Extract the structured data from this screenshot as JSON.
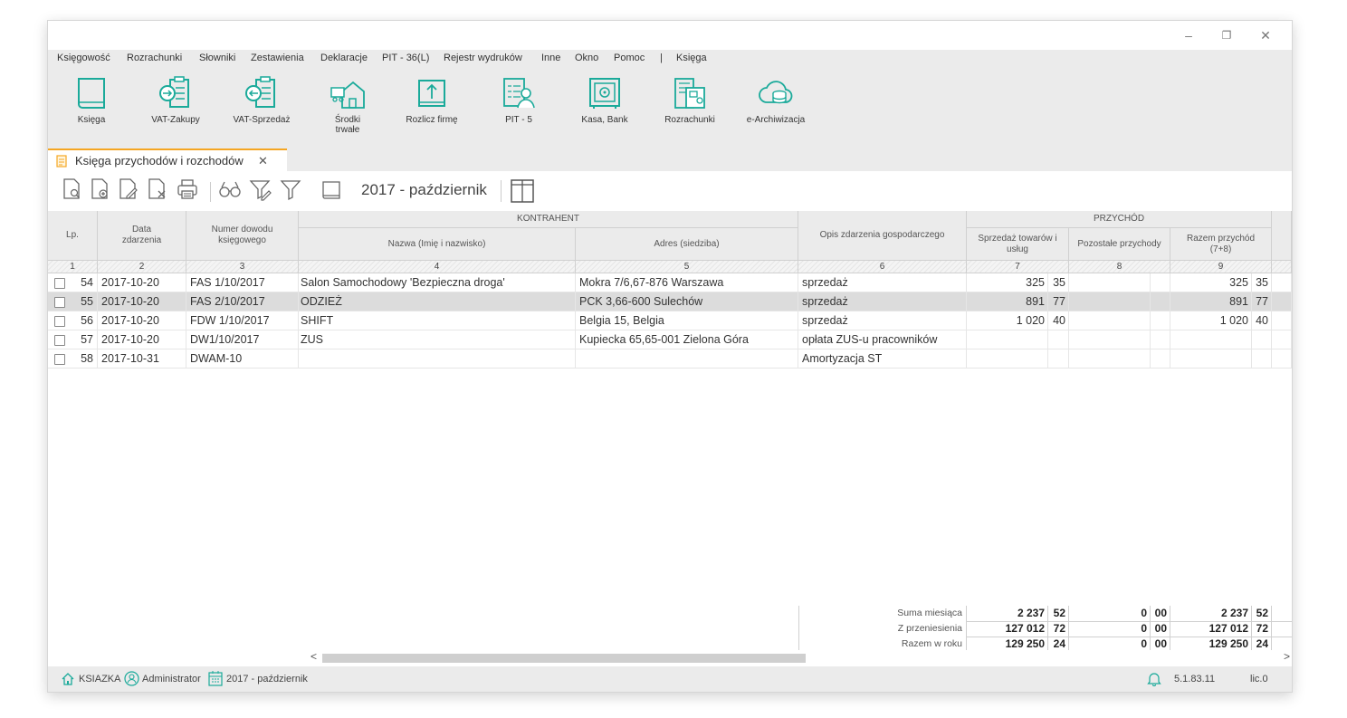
{
  "window": {
    "controls": {
      "minimize": "–",
      "restore": "❐",
      "close": "✕"
    }
  },
  "menu": [
    "Księgowość",
    "Rozrachunki",
    "Słowniki",
    "Zestawienia",
    "Deklaracje",
    "PIT - 36(L)",
    "Rejestr wydruków",
    "Inne",
    "Okno",
    "Pomoc",
    "|",
    "Księga"
  ],
  "ribbon": [
    {
      "label": "Księga",
      "icon": "book-icon"
    },
    {
      "label": "VAT-Zakupy",
      "icon": "document-in-icon"
    },
    {
      "label": "VAT-Sprzedaż",
      "icon": "document-out-icon"
    },
    {
      "label": "Środki trwałe",
      "icon": "fixed-assets-icon"
    },
    {
      "label": "Rozlicz firmę",
      "icon": "settle-icon"
    },
    {
      "label": "PIT - 5",
      "icon": "pit-icon"
    },
    {
      "label": "Kasa, Bank",
      "icon": "safe-icon"
    },
    {
      "label": "Rozrachunki",
      "icon": "settlements-icon"
    },
    {
      "label": "e-Archiwizacja",
      "icon": "cloud-archive-icon"
    }
  ],
  "tab": {
    "label": "Księga przychodów i rozchodów",
    "close": "✕"
  },
  "toolbar": {
    "period": "2017 - październik"
  },
  "accent": "#1aaa9a",
  "tab_accent": "#f5a623",
  "table": {
    "headers": {
      "lp": "Lp.",
      "data": "Data zdarzenia",
      "numer": "Numer dowodu księgowego",
      "kontrahent": "KONTRAHENT",
      "nazwa": "Nazwa (Imię i nazwisko)",
      "adres": "Adres (siedziba)",
      "opis": "Opis zdarzenia gospodarczego",
      "przychod": "PRZYCHÓD",
      "sprzedaz": "Sprzedaż towarów i usług",
      "pozostale": "Pozostałe przychody",
      "razem": "Razem przychód (7+8)"
    },
    "col_numbers": [
      "1",
      "2",
      "3",
      "4",
      "5",
      "6",
      "7",
      "8",
      "9"
    ],
    "rows": [
      {
        "lp": "54",
        "data": "2017-10-20",
        "numer": "FAS 1/10/2017",
        "nazwa": "Salon Samochodowy 'Bezpieczna droga'",
        "adres": "Mokra 7/6,67-876 Warszawa",
        "opis": "sprzedaż",
        "s_int": "325",
        "s_dec": "35",
        "p_int": "",
        "p_dec": "",
        "r_int": "325",
        "r_dec": "35"
      },
      {
        "lp": "55",
        "data": "2017-10-20",
        "numer": "FAS 2/10/2017",
        "nazwa": "ODZIEŻ",
        "adres": "PCK 3,66-600 Sulechów",
        "opis": "sprzedaż",
        "s_int": "891",
        "s_dec": "77",
        "p_int": "",
        "p_dec": "",
        "r_int": "891",
        "r_dec": "77"
      },
      {
        "lp": "56",
        "data": "2017-10-20",
        "numer": "FDW 1/10/2017",
        "nazwa": "SHIFT",
        "adres": "Belgia  15, Belgia",
        "opis": "sprzedaż",
        "s_int": "1 020",
        "s_dec": "40",
        "p_int": "",
        "p_dec": "",
        "r_int": "1 020",
        "r_dec": "40"
      },
      {
        "lp": "57",
        "data": "2017-10-20",
        "numer": "DW1/10/2017",
        "nazwa": "ZUS",
        "adres": "Kupiecka 65,65-001 Zielona Góra",
        "opis": "opłata ZUS-u pracowników",
        "s_int": "",
        "s_dec": "",
        "p_int": "",
        "p_dec": "",
        "r_int": "",
        "r_dec": ""
      },
      {
        "lp": "58",
        "data": "2017-10-31",
        "numer": "DWAM-10",
        "nazwa": "",
        "adres": "",
        "opis": "Amortyzacja ST",
        "s_int": "",
        "s_dec": "",
        "p_int": "",
        "p_dec": "",
        "r_int": "",
        "r_dec": ""
      }
    ],
    "selected_row": "55",
    "summary": [
      {
        "label": "Suma miesiąca",
        "s_int": "2 237",
        "s_dec": "52",
        "p_int": "0",
        "p_dec": "00",
        "r_int": "2 237",
        "r_dec": "52"
      },
      {
        "label": "Z przeniesienia",
        "s_int": "127 012",
        "s_dec": "72",
        "p_int": "0",
        "p_dec": "00",
        "r_int": "127 012",
        "r_dec": "72"
      },
      {
        "label": "Razem w roku",
        "s_int": "129 250",
        "s_dec": "24",
        "p_int": "0",
        "p_dec": "00",
        "r_int": "129 250",
        "r_dec": "24"
      }
    ]
  },
  "scroll": {
    "left": "<",
    "right": ">"
  },
  "status": {
    "company": "KSIAZKA",
    "user": "Administrator",
    "period": "2017  - październik",
    "version": "5.1.83.11",
    "license": "lic.0"
  }
}
